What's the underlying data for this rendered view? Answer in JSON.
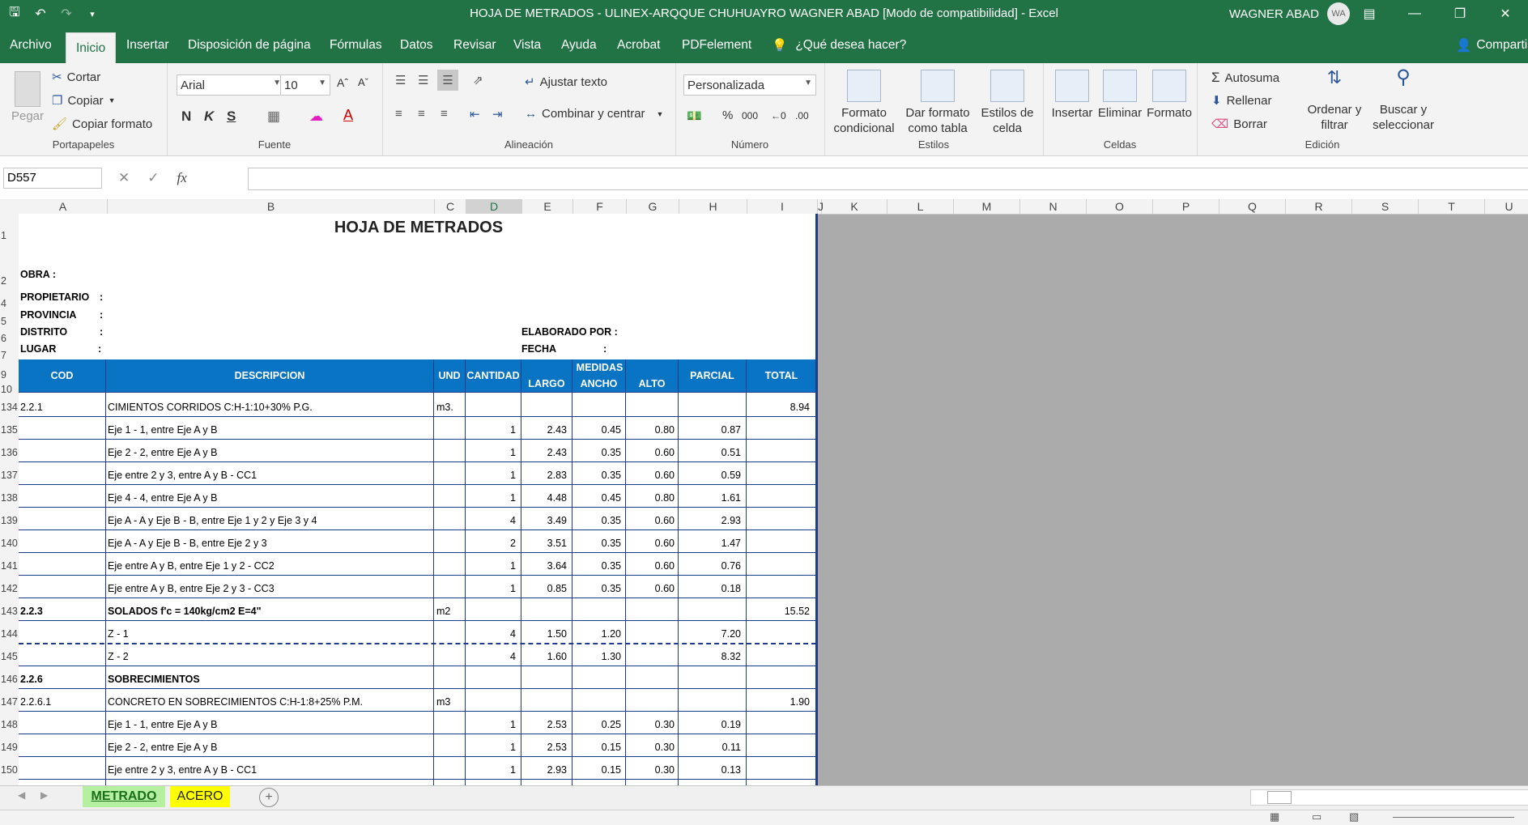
{
  "window": {
    "title": "HOJA DE METRADOS - ULINEX-ARQQUE CHUHUAYRO WAGNER ABAD  [Modo de compatibilidad]  -  Excel",
    "user": "WAGNER ABAD",
    "avatar": "WA",
    "qat_icons": [
      "save-icon",
      "undo-icon",
      "redo-icon",
      "customize-icon"
    ],
    "win_icons": [
      "ribbon-display-icon",
      "minimize-icon",
      "restore-icon",
      "close-icon"
    ]
  },
  "menu": {
    "tabs": [
      "Archivo",
      "Inicio",
      "Insertar",
      "Disposición de página",
      "Fórmulas",
      "Datos",
      "Revisar",
      "Vista",
      "Ayuda",
      "Acrobat",
      "PDFelement"
    ],
    "active": "Inicio",
    "tell_me": "¿Qué desea hacer?",
    "share": "Compartir"
  },
  "ribbon": {
    "clipboard": {
      "paste": "Pegar",
      "cut": "Cortar",
      "copy": "Copiar",
      "format_painter": "Copiar formato",
      "label": "Portapapeles"
    },
    "font": {
      "name": "Arial",
      "size": "10",
      "bold": "N",
      "italic": "K",
      "underline": "S",
      "label": "Fuente"
    },
    "alignment": {
      "wrap": "Ajustar texto",
      "merge": "Combinar y centrar",
      "label": "Alineación"
    },
    "number": {
      "format": "Personalizada",
      "percent": "%",
      "thousands": "000",
      "label": "Número"
    },
    "styles": {
      "conditional": "Formato condicional",
      "as_table": "Dar formato como tabla",
      "cell_styles": "Estilos de celda",
      "label": "Estilos"
    },
    "cells": {
      "insert": "Insertar",
      "delete": "Eliminar",
      "format": "Formato",
      "label": "Celdas"
    },
    "editing": {
      "autosum": "Autosuma",
      "fill": "Rellenar",
      "clear": "Borrar",
      "sort": "Ordenar y filtrar",
      "find": "Buscar y seleccionar",
      "label": "Edición"
    }
  },
  "formula_bar": {
    "name_box": "D557",
    "fx": "fx",
    "value": ""
  },
  "columns": [
    "A",
    "B",
    "C",
    "D",
    "E",
    "F",
    "G",
    "H",
    "I",
    "J",
    "K",
    "L",
    "M",
    "N",
    "O",
    "P",
    "Q",
    "R",
    "S",
    "T",
    "U"
  ],
  "sheet": {
    "title": "HOJA DE METRADOS",
    "obra": "OBRA  :",
    "propietario": "PROPIETARIO",
    "provincia": "PROVINCIA",
    "distrito": "DISTRITO",
    "lugar": "LUGAR",
    "colon": ":",
    "elaborado": "ELABORADO POR :",
    "fecha": "FECHA",
    "headers": {
      "cod": "COD",
      "desc": "DESCRIPCION",
      "und": "UND",
      "cant": "CANTIDAD",
      "medidas": "MEDIDAS",
      "largo": "LARGO",
      "ancho": "ANCHO",
      "alto": "ALTO",
      "parcial": "PARCIAL",
      "total": "TOTAL"
    },
    "header_rows": [
      "1",
      "2",
      "4",
      "5",
      "6",
      "7",
      "9",
      "10"
    ],
    "rows": [
      {
        "n": "134",
        "cod": "2.2.1",
        "desc": "CIMIENTOS CORRIDOS C:H-1:10+30% P.G.",
        "und": "m3.",
        "cant": "",
        "largo": "",
        "ancho": "",
        "alto": "",
        "parcial": "",
        "total": "8.94",
        "bold": false
      },
      {
        "n": "135",
        "cod": "",
        "desc": "Eje 1 - 1, entre Eje A y B",
        "und": "",
        "cant": "1",
        "largo": "2.43",
        "ancho": "0.45",
        "alto": "0.80",
        "parcial": "0.87",
        "total": "",
        "bold": false
      },
      {
        "n": "136",
        "cod": "",
        "desc": "Eje 2 - 2, entre Eje A y B",
        "und": "",
        "cant": "1",
        "largo": "2.43",
        "ancho": "0.35",
        "alto": "0.60",
        "parcial": "0.51",
        "total": "",
        "bold": false
      },
      {
        "n": "137",
        "cod": "",
        "desc": "Eje entre 2 y 3, entre A y B - CC1",
        "und": "",
        "cant": "1",
        "largo": "2.83",
        "ancho": "0.35",
        "alto": "0.60",
        "parcial": "0.59",
        "total": "",
        "bold": false
      },
      {
        "n": "138",
        "cod": "",
        "desc": "Eje 4 - 4, entre Eje A y B",
        "und": "",
        "cant": "1",
        "largo": "4.48",
        "ancho": "0.45",
        "alto": "0.80",
        "parcial": "1.61",
        "total": "",
        "bold": false
      },
      {
        "n": "139",
        "cod": "",
        "desc": "Eje A - A y Eje B - B, entre Eje 1 y 2 y Eje 3 y 4",
        "und": "",
        "cant": "4",
        "largo": "3.49",
        "ancho": "0.35",
        "alto": "0.60",
        "parcial": "2.93",
        "total": "",
        "bold": false
      },
      {
        "n": "140",
        "cod": "",
        "desc": "Eje A - A y Eje B - B, entre Eje 2 y 3",
        "und": "",
        "cant": "2",
        "largo": "3.51",
        "ancho": "0.35",
        "alto": "0.60",
        "parcial": "1.47",
        "total": "",
        "bold": false
      },
      {
        "n": "141",
        "cod": "",
        "desc": "Eje entre A y B, entre Eje 1 y 2 - CC2",
        "und": "",
        "cant": "1",
        "largo": "3.64",
        "ancho": "0.35",
        "alto": "0.60",
        "parcial": "0.76",
        "total": "",
        "bold": false
      },
      {
        "n": "142",
        "cod": "",
        "desc": "Eje entre A y B, entre Eje 2 y 3 - CC3",
        "und": "",
        "cant": "1",
        "largo": "0.85",
        "ancho": "0.35",
        "alto": "0.60",
        "parcial": "0.18",
        "total": "",
        "bold": false
      },
      {
        "n": "143",
        "cod": "2.2.3",
        "desc": "SOLADOS  f'c = 140kg/cm2  E=4\"",
        "und": "m2",
        "cant": "",
        "largo": "",
        "ancho": "",
        "alto": "",
        "parcial": "",
        "total": "15.52",
        "bold": true
      },
      {
        "n": "144",
        "cod": "",
        "desc": "Z - 1",
        "und": "",
        "cant": "4",
        "largo": "1.50",
        "ancho": "1.20",
        "alto": "",
        "parcial": "7.20",
        "total": "",
        "bold": false
      },
      {
        "n": "145",
        "cod": "",
        "desc": "Z - 2",
        "und": "",
        "cant": "4",
        "largo": "1.60",
        "ancho": "1.30",
        "alto": "",
        "parcial": "8.32",
        "total": "",
        "bold": false
      },
      {
        "n": "146",
        "cod": "2.2.6",
        "desc": "SOBRECIMIENTOS",
        "und": "",
        "cant": "",
        "largo": "",
        "ancho": "",
        "alto": "",
        "parcial": "",
        "total": "",
        "bold": true
      },
      {
        "n": "147",
        "cod": "2.2.6.1",
        "desc": "CONCRETO EN SOBRECIMIENTOS C:H-1:8+25% P.M.",
        "und": "m3",
        "cant": "",
        "largo": "",
        "ancho": "",
        "alto": "",
        "parcial": "",
        "total": "1.90",
        "bold": false
      },
      {
        "n": "148",
        "cod": "",
        "desc": "Eje 1 - 1, entre Eje A y B",
        "und": "",
        "cant": "1",
        "largo": "2.53",
        "ancho": "0.25",
        "alto": "0.30",
        "parcial": "0.19",
        "total": "",
        "bold": false
      },
      {
        "n": "149",
        "cod": "",
        "desc": "Eje 2 - 2, entre Eje A y B",
        "und": "",
        "cant": "1",
        "largo": "2.53",
        "ancho": "0.15",
        "alto": "0.30",
        "parcial": "0.11",
        "total": "",
        "bold": false
      },
      {
        "n": "150",
        "cod": "",
        "desc": "Eje entre 2 y 3, entre A y B - CC1",
        "und": "",
        "cant": "1",
        "largo": "2.93",
        "ancho": "0.15",
        "alto": "0.30",
        "parcial": "0.13",
        "total": "",
        "bold": false
      }
    ]
  },
  "sheet_tabs": [
    {
      "label": "METRADO",
      "bg": "#b4f0a0",
      "color": "#1a6e1a",
      "active": true
    },
    {
      "label": "ACERO",
      "bg": "#ffff00",
      "color": "#222222",
      "active": false
    }
  ],
  "colors": {
    "excel_green": "#217346",
    "table_header": "#0a74c4",
    "grid_line": "#1f3c88"
  }
}
